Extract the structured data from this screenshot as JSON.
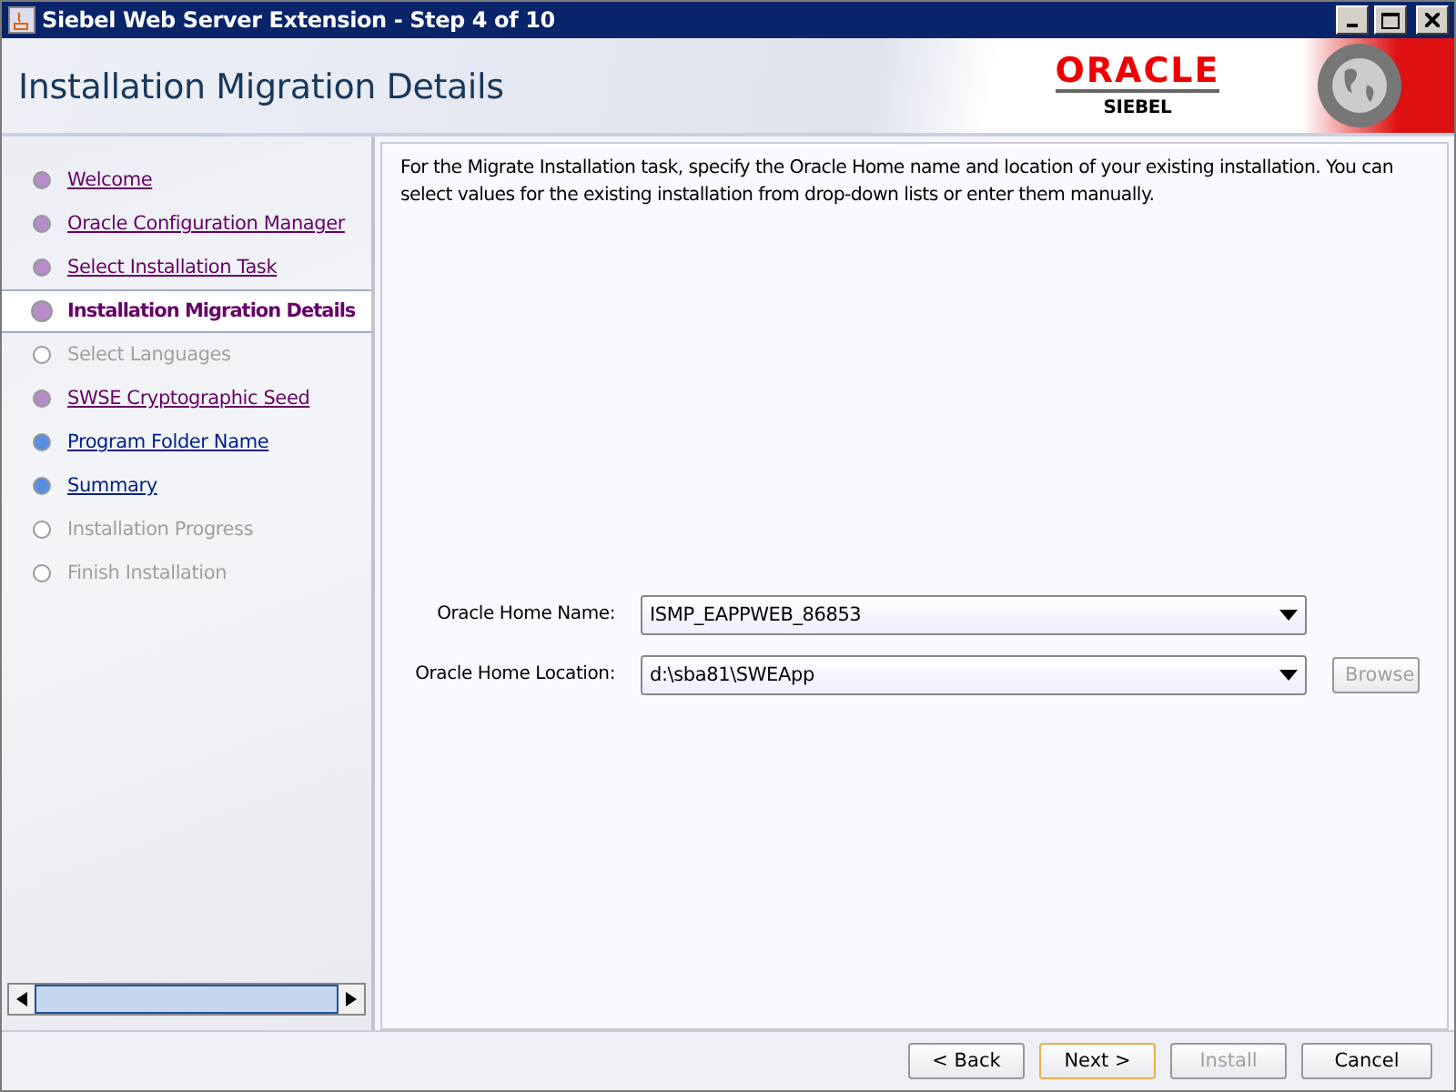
{
  "window": {
    "title": "Siebel Web Server Extension - Step 4 of 10"
  },
  "header": {
    "title": "Installation Migration Details",
    "brand": "ORACLE",
    "product": "SIEBEL"
  },
  "steps": [
    {
      "label": "Welcome",
      "kind": "visited",
      "selected": false
    },
    {
      "label": "Oracle Configuration Manager",
      "kind": "visited",
      "selected": false
    },
    {
      "label": "Select Installation Task",
      "kind": "visited",
      "selected": false
    },
    {
      "label": "Installation Migration Details",
      "kind": "current",
      "selected": true
    },
    {
      "label": "Select Languages",
      "kind": "disabled",
      "selected": false
    },
    {
      "label": "SWSE Cryptographic Seed",
      "kind": "visited",
      "selected": false
    },
    {
      "label": "Program Folder Name",
      "kind": "link",
      "selected": false
    },
    {
      "label": "Summary",
      "kind": "link",
      "selected": false
    },
    {
      "label": "Installation Progress",
      "kind": "disabled",
      "selected": false
    },
    {
      "label": "Finish Installation",
      "kind": "disabled",
      "selected": false
    }
  ],
  "description": "For the Migrate Installation task, specify the Oracle Home name and location of your existing installation. You can select values for the existing installation from drop-down lists or enter them manually.",
  "fields": [
    {
      "label": "Oracle Home Name:",
      "value": "ISMP_EAPPWEB_86853"
    },
    {
      "label": "Oracle Home Location:",
      "value": "d:\\sba81\\SWEApp",
      "button": {
        "label": "Browse",
        "disabled": true
      }
    }
  ],
  "buttons": [
    {
      "label": "< Back",
      "disabled": false,
      "default": false
    },
    {
      "label": "Next >",
      "disabled": false,
      "default": true
    },
    {
      "label": "Install",
      "disabled": true,
      "default": false
    },
    {
      "label": "Cancel",
      "disabled": false,
      "default": false
    }
  ]
}
